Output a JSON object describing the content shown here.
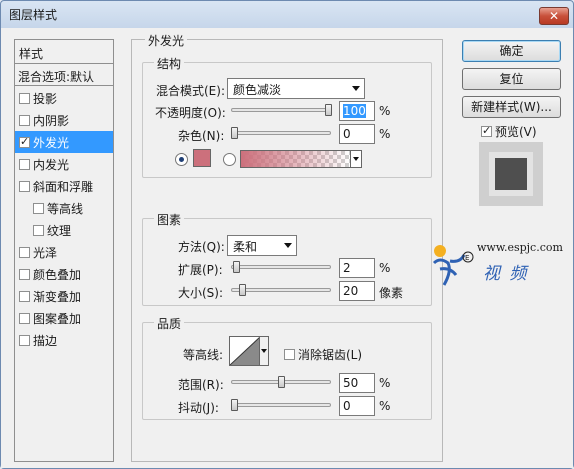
{
  "window": {
    "title": "图层样式",
    "close_glyph": "✕"
  },
  "left_list": {
    "header": "样式",
    "blend_options": "混合选项:默认",
    "items": [
      {
        "label": "投影",
        "checked": false,
        "sub": false,
        "selected": false
      },
      {
        "label": "内阴影",
        "checked": false,
        "sub": false,
        "selected": false
      },
      {
        "label": "外发光",
        "checked": true,
        "sub": false,
        "selected": true
      },
      {
        "label": "内发光",
        "checked": false,
        "sub": false,
        "selected": false
      },
      {
        "label": "斜面和浮雕",
        "checked": false,
        "sub": false,
        "selected": false
      },
      {
        "label": "等高线",
        "checked": false,
        "sub": true,
        "selected": false
      },
      {
        "label": "纹理",
        "checked": false,
        "sub": true,
        "selected": false
      },
      {
        "label": "光泽",
        "checked": false,
        "sub": false,
        "selected": false
      },
      {
        "label": "颜色叠加",
        "checked": false,
        "sub": false,
        "selected": false
      },
      {
        "label": "渐变叠加",
        "checked": false,
        "sub": false,
        "selected": false
      },
      {
        "label": "图案叠加",
        "checked": false,
        "sub": false,
        "selected": false
      },
      {
        "label": "描边",
        "checked": false,
        "sub": false,
        "selected": false
      }
    ]
  },
  "outer_glow": {
    "title": "外发光",
    "structure": {
      "title": "结构",
      "blend_mode_label": "混合模式(E):",
      "blend_mode_value": "颜色减淡",
      "opacity_label": "不透明度(O):",
      "opacity_value": "100",
      "opacity_level": 1.0,
      "noise_label": "杂色(N):",
      "noise_value": "0",
      "noise_level": 0.0,
      "unit": "%",
      "color_mode": "solid",
      "glow_color": "#cc707c"
    },
    "elements": {
      "title": "图素",
      "technique_label": "方法(Q):",
      "technique_value": "柔和",
      "spread_label": "扩展(P):",
      "spread_value": "2",
      "spread_level": 0.02,
      "size_label": "大小(S):",
      "size_value": "20",
      "size_level": 0.08,
      "size_unit": "像素",
      "unit": "%"
    },
    "quality": {
      "title": "品质",
      "contour_label": "等高线:",
      "anti_alias_label": "消除锯齿(L)",
      "anti_alias_checked": false,
      "range_label": "范围(R):",
      "range_value": "50",
      "range_level": 0.5,
      "jitter_label": "抖动(J):",
      "jitter_value": "0",
      "jitter_level": 0.0,
      "unit": "%"
    }
  },
  "buttons": {
    "ok": "确定",
    "reset": "复位",
    "new_style": "新建样式(W)...",
    "preview_label": "预览(V)",
    "preview_checked": true
  },
  "watermark": {
    "url": "www.espjc.com",
    "cn": "视 频"
  }
}
